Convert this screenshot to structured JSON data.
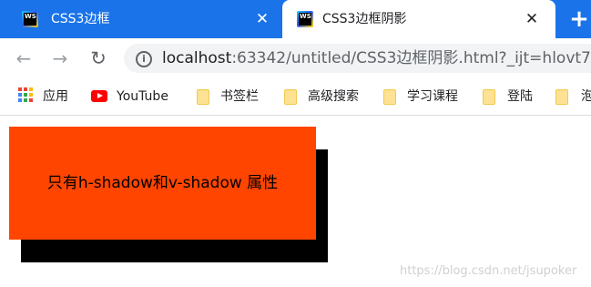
{
  "tabs": [
    {
      "title": "CSS3边框",
      "close_glyph": "✕",
      "icon": "webstorm-icon",
      "icon_text": "WS",
      "active": false
    },
    {
      "title": "CSS3边框阴影",
      "close_glyph": "✕",
      "icon": "webstorm-icon",
      "icon_text": "WS",
      "active": true
    }
  ],
  "new_tab_glyph": "+",
  "toolbar": {
    "back_glyph": "←",
    "forward_glyph": "→",
    "reload_glyph": "↻",
    "info_glyph": "i",
    "url_host": "localhost",
    "url_rest": ":63342/untitled/CSS3边框阴影.html?_ijt=hlovt71"
  },
  "bookmarks": [
    {
      "label": "应用",
      "icon": "apps-grid-icon"
    },
    {
      "label": "YouTube",
      "icon": "youtube-icon"
    },
    {
      "label": "书签栏",
      "icon": "folder-icon"
    },
    {
      "label": "高级搜索",
      "icon": "folder-icon"
    },
    {
      "label": "学习课程",
      "icon": "folder-icon"
    },
    {
      "label": "登陆",
      "icon": "folder-icon"
    },
    {
      "label": "泡",
      "icon": "folder-icon"
    }
  ],
  "page": {
    "demo_text": "只有h-shadow和v-shadow 属性",
    "box_color": "#ff4500",
    "shadow_color": "#000000",
    "watermark": "https://blog.csdn.net/jsupoker"
  },
  "colors": {
    "tab_strip": "#1a73e8",
    "omnibox": "#f1f3f4",
    "apps_icon": [
      "#ea4335",
      "#fbbc05",
      "#34a853",
      "#4285f4"
    ]
  }
}
